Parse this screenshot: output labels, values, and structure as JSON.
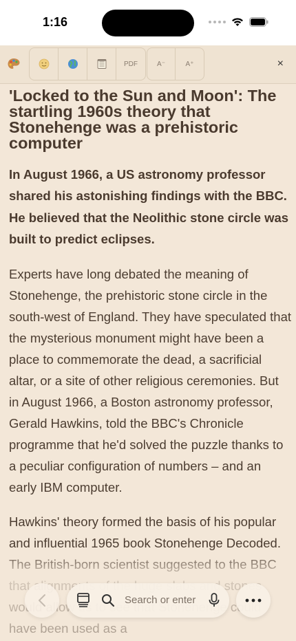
{
  "status": {
    "time": "1:16"
  },
  "toolbar": {
    "icons": [
      "palette-icon",
      "emoji-icon",
      "globe-icon",
      "notepad-icon"
    ],
    "pdf_label": "PDF",
    "font_decrease_label": "A⁻",
    "font_increase_label": "A⁺",
    "close_label": "×"
  },
  "article": {
    "title": "'Locked to the Sun and Moon': The startling 1960s theory that Stonehenge was a prehistoric computer",
    "lede": "In August 1966, a US astronomy professor shared his astonishing findings with the BBC. He believed that the Neolithic stone circle was built to predict eclipses.",
    "paragraphs": [
      "Experts have long debated the meaning of Stonehenge, the prehistoric stone circle in the south-west of England. They have speculated that the mysterious monument might have been a place to commemorate the dead, a sacrificial altar, or a site of other religious ceremonies. But in August 1966, a Boston astronomy professor, Gerald Hawkins, told the BBC's Chronicle programme that he'd solved the puzzle thanks to a peculiar configuration of numbers – and an early IBM computer.",
      "Hawkins' theory formed the basis of his popular and influential 1965 book Stonehenge Decoded. The British-born scientist suggested to the BBC that alignments of the huge slabs and stones would allow us to see that Stonehenge could have been used as a"
    ]
  },
  "bottom": {
    "search_placeholder": "Search or enter"
  },
  "colors": {
    "background": "#f3e7d8",
    "text": "#4c3d31"
  }
}
